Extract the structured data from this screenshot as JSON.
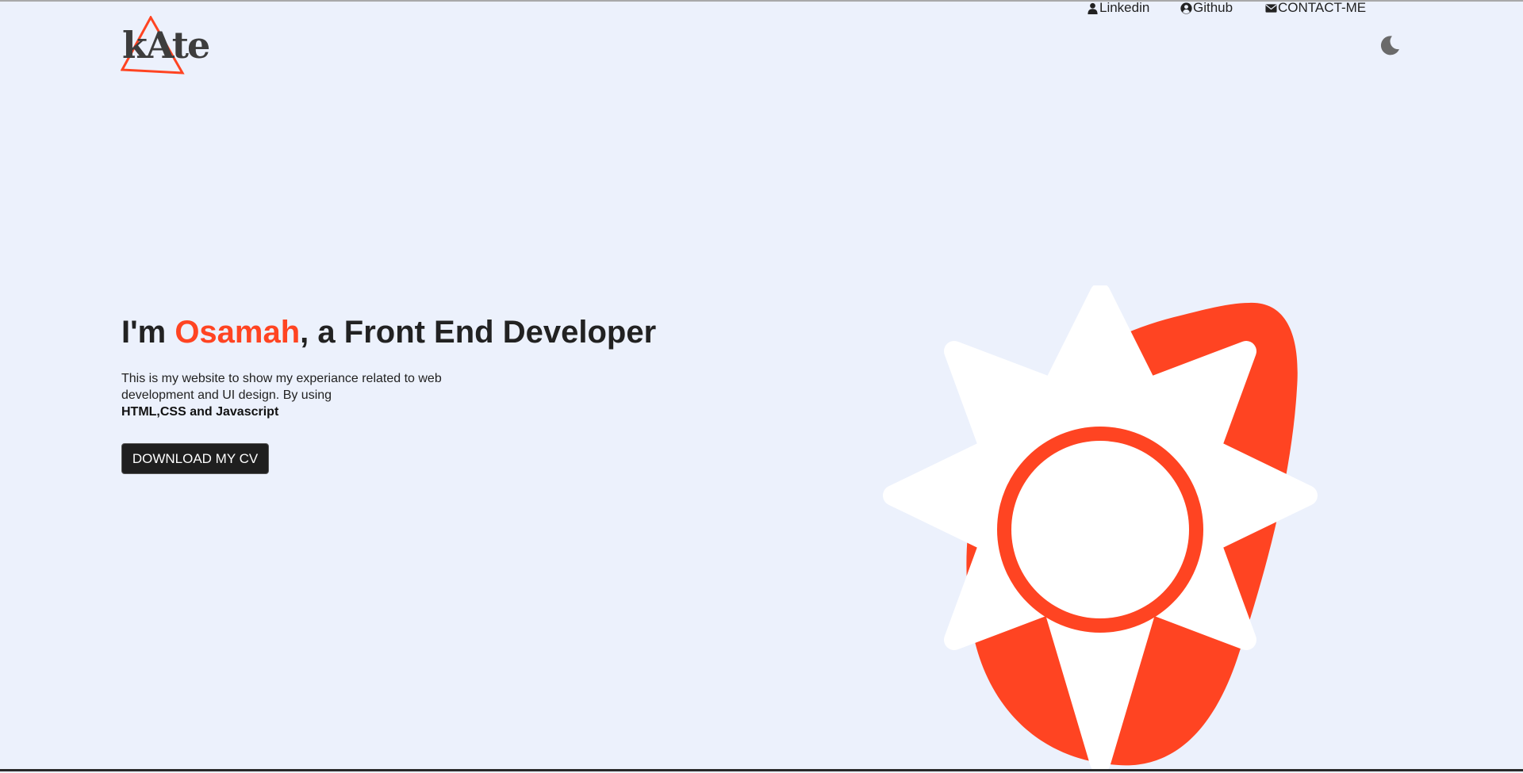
{
  "header": {
    "logo_text": "kAte",
    "nav": [
      {
        "label": "Linkedin",
        "icon": "user-icon"
      },
      {
        "label": "Github",
        "icon": "github-icon"
      },
      {
        "label": "CONTACT-ME",
        "icon": "envelope-icon"
      }
    ],
    "theme_toggle_icon": "moon-icon"
  },
  "hero": {
    "title_prefix": "I'm ",
    "title_name": "Osamah",
    "title_suffix": ", a Front End Developer",
    "description": "This is my website to show my experiance related to web development and UI design. By using",
    "stack": "HTML,CSS and Javascript",
    "cta_label": "DOWNLOAD MY CV"
  },
  "illustration": {
    "icon": "sun-icon"
  },
  "colors": {
    "accent": "#ff4422",
    "background": "#ecf1fc",
    "text": "#222222",
    "button_bg": "#1f1f1f"
  }
}
